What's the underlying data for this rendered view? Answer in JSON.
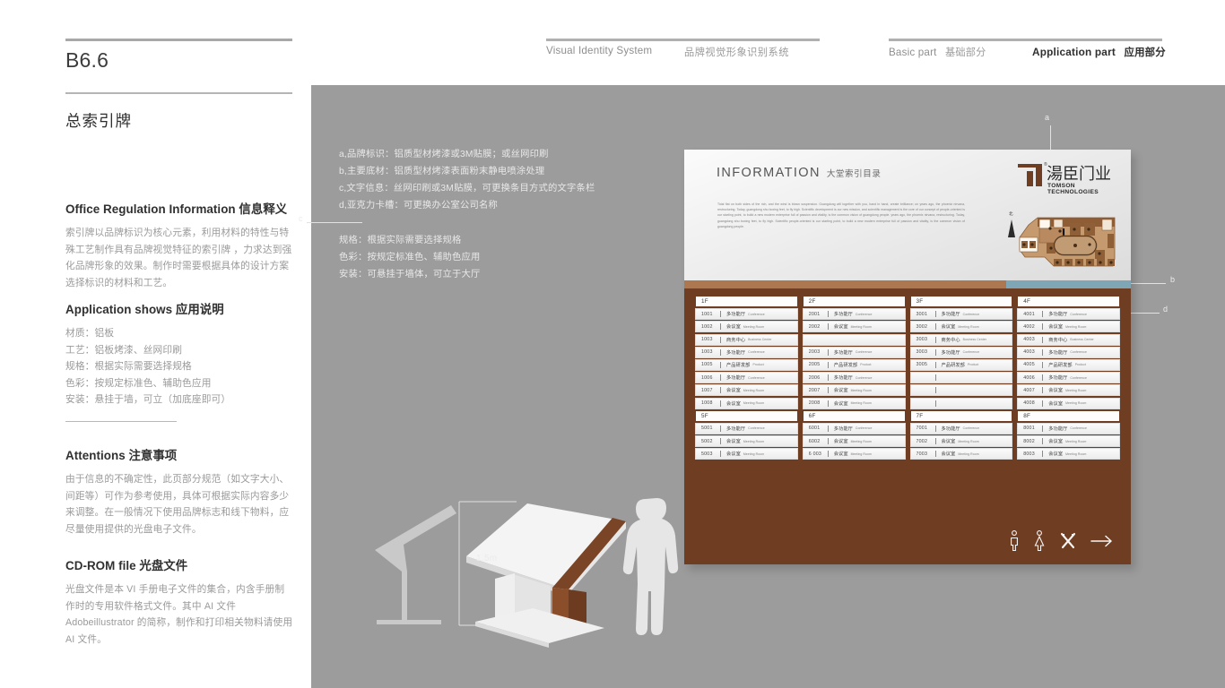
{
  "header": {
    "left_rule": true,
    "items": [
      {
        "en": "Visual Identity System",
        "cn": "品牌视觉形象识别系统",
        "active": false
      },
      {
        "en": "Basic part",
        "cn": "基础部分",
        "active": false
      },
      {
        "en": "Application part",
        "cn": "应用部分",
        "active": true
      }
    ]
  },
  "sidebar": {
    "code": "B6.6",
    "title": "总索引牌",
    "sections": [
      {
        "heading": "Office Regulation Information 信息释义",
        "body": "索引牌以品牌标识为核心元素，利用材料的特性与特殊工艺制作具有品牌视觉特征的索引牌 ，力求达到强化品牌形象的效果。制作时需要根据具体的设计方案选择标识的材料和工艺。"
      },
      {
        "heading": "Application shows 应用说明",
        "lines": [
          "材质：铝板",
          "工艺：铝板烤漆、丝网印刷",
          "规格：根据实际需要选择规格",
          "色彩：按规定标准色、辅助色应用",
          "安装：悬挂于墙，可立（加底座即可）"
        ]
      },
      {
        "heading": "Attentions 注意事项",
        "body": "由于信息的不确定性，此页部分规范（如文字大小、间距等）可作为参考使用，具体可根据实际内容多少来调整。在一般情况下使用品牌标志和线下物料，应尽量使用提供的光盘电子文件。"
      },
      {
        "heading": "CD-ROM file 光盘文件",
        "body": "光盘文件是本 VI 手册电子文件的集合，内含手册制作时的专用软件格式文件。其中 AI 文件 Adobeillustrator 的简称，制作和打印相关物料请使用 AI 文件。"
      }
    ]
  },
  "spec": {
    "group_a": [
      "a,品牌标识：铝质型材烤漆或3M贴膜；或丝网印刷",
      "b,主要底材：铝质型材烤漆表面粉末静电喷涂处理",
      "c,文字信息：丝网印刷或3M贴膜，可更换条目方式的文字条栏",
      "d,亚克力卡槽：可更换办公室公司名称"
    ],
    "group_b": [
      "规格：根据实际需要选择规格",
      "色彩：按规定标准色、辅助色应用",
      "安装：可悬挂于墙体，可立于大厅"
    ]
  },
  "callouts": [
    {
      "id": "a",
      "label": "a"
    },
    {
      "id": "b",
      "label": "b"
    },
    {
      "id": "c",
      "label": "c"
    },
    {
      "id": "d",
      "label": "d"
    }
  ],
  "sign": {
    "title_en": "INFORMATION",
    "title_cn": "大堂索引目录",
    "body": "Tidal flat on both sides of the rich, and the wind is blown suspension. Guangdong will together with you, hand in hand, create brilliance; on years ago, the phoenix nirvana, restructuring. Today, guangdong shu boxing feet, to fly high. Scientific development is our new mission, and scientific management is the core of our concept of people-oriented is our starting point, to build a new modern enterprise full of passion and vitality, is the common vision of guangdong people. years ago, the phoenix nirvana, restructuring. Today, guangdong shu boxing feet, to fly high. Scientific people-oriented is our starting point, to build a new modern enterprise full of passion and vitality, is the common vision of guangdong people.",
    "logo_cn": "湯臣门业",
    "logo_en": "TOMSON TECHNOLOGIES",
    "logo_reg": "®",
    "plan_north": "北",
    "pictograms": [
      "male-restroom-icon",
      "female-restroom-icon",
      "restaurant-icon",
      "arrow-right-icon"
    ],
    "colors": {
      "brown": "#6f3d22",
      "band_left": "#ad7750",
      "band_right": "#7ea6b5",
      "head": "#eeeeee"
    }
  },
  "directory": {
    "columns": [
      {
        "floors": [
          {
            "floor": "1F",
            "rooms": [
              {
                "num": "1001",
                "cn": "多功能厅",
                "en": "Conference"
              },
              {
                "num": "1002",
                "cn": "会议室",
                "en": "Meeting Room"
              },
              {
                "num": "1003",
                "cn": "商务中心",
                "en": "Business Center"
              },
              {
                "num": "1003",
                "cn": "多功能厅",
                "en": "Conference"
              },
              {
                "num": "1005",
                "cn": "产品研发部",
                "en": "Product"
              },
              {
                "num": "1006",
                "cn": "多功能厅",
                "en": "Conference"
              },
              {
                "num": "1007",
                "cn": "会议室",
                "en": "Meeting Room"
              },
              {
                "num": "1008",
                "cn": "会议室",
                "en": "Meeting Room"
              }
            ]
          },
          {
            "floor": "5F",
            "rooms": [
              {
                "num": "5001",
                "cn": "多功能厅",
                "en": "Conference"
              },
              {
                "num": "5002",
                "cn": "会议室",
                "en": "Meeting Room"
              },
              {
                "num": "5003",
                "cn": "会议室",
                "en": "Meeting Room"
              }
            ]
          }
        ]
      },
      {
        "floors": [
          {
            "floor": "2F",
            "rooms": [
              {
                "num": "2001",
                "cn": "多功能厅",
                "en": "Conference"
              },
              {
                "num": "2002",
                "cn": "会议室",
                "en": "Meeting Room"
              },
              {
                "num": "",
                "cn": "",
                "en": ""
              },
              {
                "num": "2003",
                "cn": "多功能厅",
                "en": "Conference"
              },
              {
                "num": "2005",
                "cn": "产品研发部",
                "en": "Product"
              },
              {
                "num": "2006",
                "cn": "多功能厅",
                "en": "Conference"
              },
              {
                "num": "2007",
                "cn": "会议室",
                "en": "Meeting Room"
              },
              {
                "num": "2008",
                "cn": "会议室",
                "en": "Meeting Room"
              }
            ]
          },
          {
            "floor": "6F",
            "rooms": [
              {
                "num": "6001",
                "cn": "多功能厅",
                "en": "Conference"
              },
              {
                "num": "6002",
                "cn": "会议室",
                "en": "Meeting Room"
              },
              {
                "num": "6 003",
                "cn": "会议室",
                "en": "Meeting Room"
              }
            ]
          }
        ]
      },
      {
        "floors": [
          {
            "floor": "3F",
            "rooms": [
              {
                "num": "3001",
                "cn": "多功能厅",
                "en": "Conference"
              },
              {
                "num": "3002",
                "cn": "会议室",
                "en": "Meeting Room"
              },
              {
                "num": "3003",
                "cn": "商务中心",
                "en": "Business Center"
              },
              {
                "num": "3003",
                "cn": "多功能厅",
                "en": "Conference"
              },
              {
                "num": "3005",
                "cn": "产品研发部",
                "en": "Product"
              },
              {
                "num": "",
                "cn": "",
                "en": ""
              },
              {
                "num": "",
                "cn": "",
                "en": ""
              },
              {
                "num": "",
                "cn": "",
                "en": ""
              }
            ]
          },
          {
            "floor": "7F",
            "rooms": [
              {
                "num": "7001",
                "cn": "多功能厅",
                "en": "Conference"
              },
              {
                "num": "7002",
                "cn": "会议室",
                "en": "Meeting Room"
              },
              {
                "num": "7003",
                "cn": "会议室",
                "en": "Meeting Room"
              }
            ]
          }
        ]
      },
      {
        "floors": [
          {
            "floor": "4F",
            "rooms": [
              {
                "num": "4001",
                "cn": "多功能厅",
                "en": "Conference"
              },
              {
                "num": "4002",
                "cn": "会议室",
                "en": "Meeting Room"
              },
              {
                "num": "4003",
                "cn": "商务中心",
                "en": "Business Center"
              },
              {
                "num": "4003",
                "cn": "多功能厅",
                "en": "Conference"
              },
              {
                "num": "4005",
                "cn": "产品研发部",
                "en": "Product"
              },
              {
                "num": "4006",
                "cn": "多功能厅",
                "en": "Conference"
              },
              {
                "num": "4007",
                "cn": "会议室",
                "en": "Meeting Room"
              },
              {
                "num": "4008",
                "cn": "会议室",
                "en": "Meeting Room"
              }
            ]
          },
          {
            "floor": "8F",
            "rooms": [
              {
                "num": "8001",
                "cn": "多功能厅",
                "en": "Conference"
              },
              {
                "num": "8002",
                "cn": "会议室",
                "en": "Meeting Room"
              },
              {
                "num": "8003",
                "cn": "会议室",
                "en": "Meeting Room"
              }
            ]
          }
        ]
      }
    ]
  },
  "illustration": {
    "dimension": "1.5m"
  }
}
